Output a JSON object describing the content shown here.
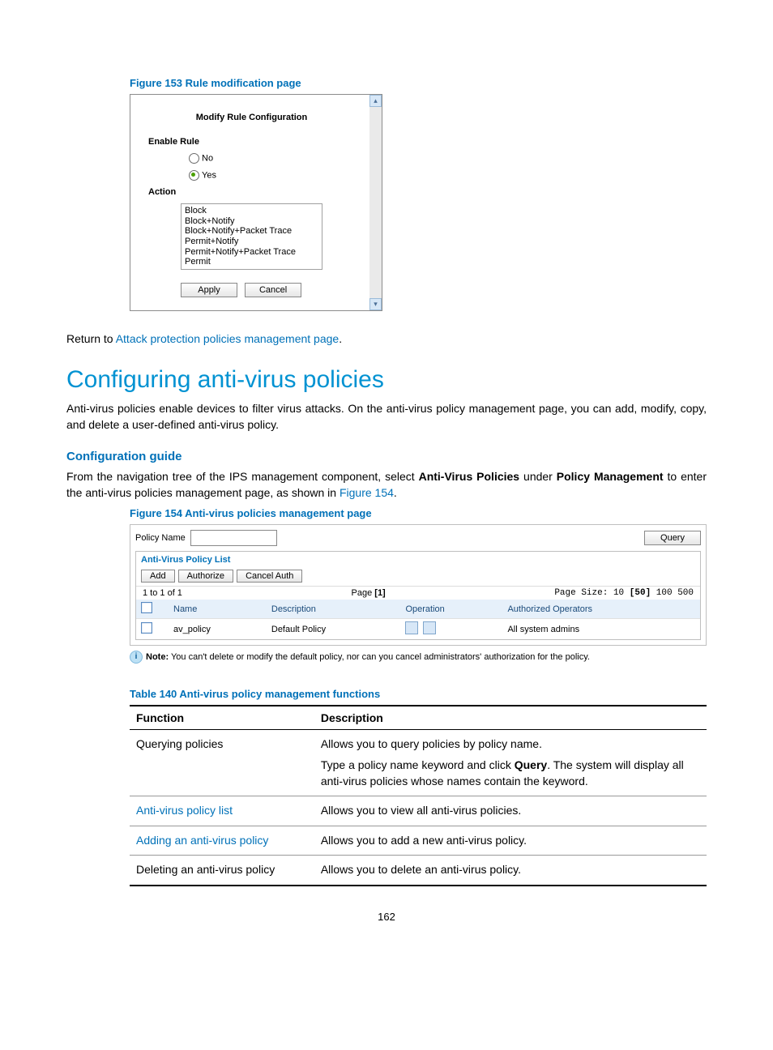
{
  "fig153": {
    "caption": "Figure 153 Rule modification page",
    "title": "Modify Rule Configuration",
    "enable_label": "Enable Rule",
    "radio_no": "No",
    "radio_yes": "Yes",
    "radio_selected": "yes",
    "action_label": "Action",
    "action_options": [
      "Block",
      "Block+Notify",
      "Block+Notify+Packet Trace",
      "Permit+Notify",
      "Permit+Notify+Packet Trace",
      "Permit"
    ],
    "apply_btn": "Apply",
    "cancel_btn": "Cancel"
  },
  "return_text": {
    "prefix": "Return to ",
    "link": "Attack protection policies management page",
    "suffix": "."
  },
  "h1": "Configuring anti-virus policies",
  "intro": "Anti-virus policies enable devices to filter virus attacks. On the anti-virus policy management page, you can add, modify, copy, and delete a user-defined anti-virus policy.",
  "config_guide_title": "Configuration guide",
  "config_guide_body_pre": "From the navigation tree of the IPS management component, select ",
  "config_guide_bold1": "Anti-Virus Policies",
  "config_guide_mid": " under ",
  "config_guide_bold2": "Policy Management",
  "config_guide_post": " to enter the anti-virus policies management page, as shown in ",
  "config_guide_link": "Figure 154",
  "config_guide_end": ".",
  "fig154": {
    "caption": "Figure 154 Anti-virus policies management page",
    "policy_name_label": "Policy Name",
    "query_btn": "Query",
    "list_title": "Anti-Virus Policy List",
    "toolbar": {
      "add": "Add",
      "authorize": "Authorize",
      "cancel_auth": "Cancel Auth"
    },
    "pager_count": "1 to 1 of 1",
    "page_label": "Page ",
    "page_current": "[1]",
    "page_size_label": "Page Size: ",
    "page_sizes": [
      "10",
      "[50]",
      "100",
      "500"
    ],
    "columns": [
      "",
      "Name",
      "Description",
      "Operation",
      "Authorized Operators"
    ],
    "rows": [
      {
        "name": "av_policy",
        "description": "Default Policy",
        "operators": "All system admins"
      }
    ],
    "note_bold": "Note:",
    "note_text": " You can't delete or modify the default policy, nor can you cancel administrators' authorization for the policy."
  },
  "table140": {
    "caption": "Table 140 Anti-virus policy management functions",
    "header_function": "Function",
    "header_description": "Description",
    "rows": [
      {
        "function": "Querying policies",
        "is_link": false,
        "desc_line1": "Allows you to query policies by policy name.",
        "desc_line2_pre": "Type a policy name keyword and click ",
        "desc_line2_bold": "Query",
        "desc_line2_post": ". The system will display all anti-virus policies whose names contain the keyword."
      },
      {
        "function": "Anti-virus policy list",
        "is_link": true,
        "desc_line1": "Allows you to view all anti-virus policies."
      },
      {
        "function": "Adding an anti-virus policy",
        "is_link": true,
        "desc_line1": "Allows you to add a new anti-virus policy."
      },
      {
        "function": "Deleting an anti-virus policy",
        "is_link": false,
        "desc_line1": "Allows you to delete an anti-virus policy."
      }
    ]
  },
  "page_number": "162"
}
